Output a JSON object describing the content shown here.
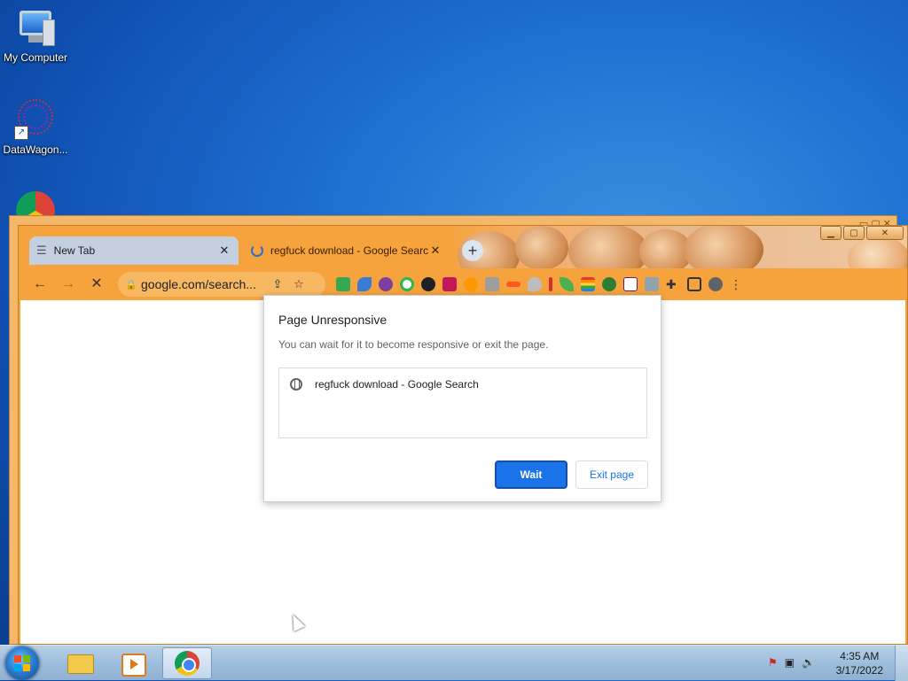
{
  "desktop": {
    "icons": [
      {
        "label": "My Computer"
      },
      {
        "label": "DataWagon..."
      }
    ]
  },
  "browser": {
    "tabs": [
      {
        "label": "New Tab",
        "close": "✕"
      },
      {
        "label": "regfuck download - Google Search",
        "close": "✕"
      }
    ],
    "new_tab": "+",
    "address": "google.com/search...",
    "nav": {
      "back": "←",
      "forward": "→",
      "stop": "✕"
    },
    "extensions": [
      {
        "icon": "meet-icon",
        "color": "#34a853"
      },
      {
        "icon": "plane-icon",
        "color": "#3a7bd5"
      },
      {
        "icon": "alien-icon",
        "color": "#7a3fa0"
      },
      {
        "icon": "ring-icon",
        "color": "#2fb84a"
      },
      {
        "icon": "disc-icon",
        "color": "#202124"
      },
      {
        "icon": "bus-icon",
        "color": "#c2185b"
      },
      {
        "icon": "avatar-ext-icon",
        "color": "#ff9800"
      },
      {
        "icon": "square-ext-icon",
        "color": "#9e9e9e"
      },
      {
        "icon": "pen-icon",
        "color": "#ff5722"
      },
      {
        "icon": "drop-icon",
        "color": "#bdbdbd"
      },
      {
        "icon": "bar-icon",
        "color": "#d32f2f"
      },
      {
        "icon": "leaf-icon",
        "color": "#4caf50"
      },
      {
        "icon": "rainbow-icon",
        "color": "#e91e63"
      },
      {
        "icon": "download-ext-icon",
        "color": "#2e7d32"
      },
      {
        "icon": "slack-icon",
        "color": "#611f69"
      },
      {
        "icon": "cat-icon",
        "color": "#90a4ae"
      }
    ]
  },
  "dialog": {
    "title": "Page Unresponsive",
    "subtitle": "You can wait for it to become responsive or exit the page.",
    "page_entry": "regfuck download - Google Search",
    "wait_label": "Wait",
    "exit_label": "Exit page"
  },
  "taskbar": {
    "time": "4:35 AM",
    "date": "3/17/2022"
  }
}
